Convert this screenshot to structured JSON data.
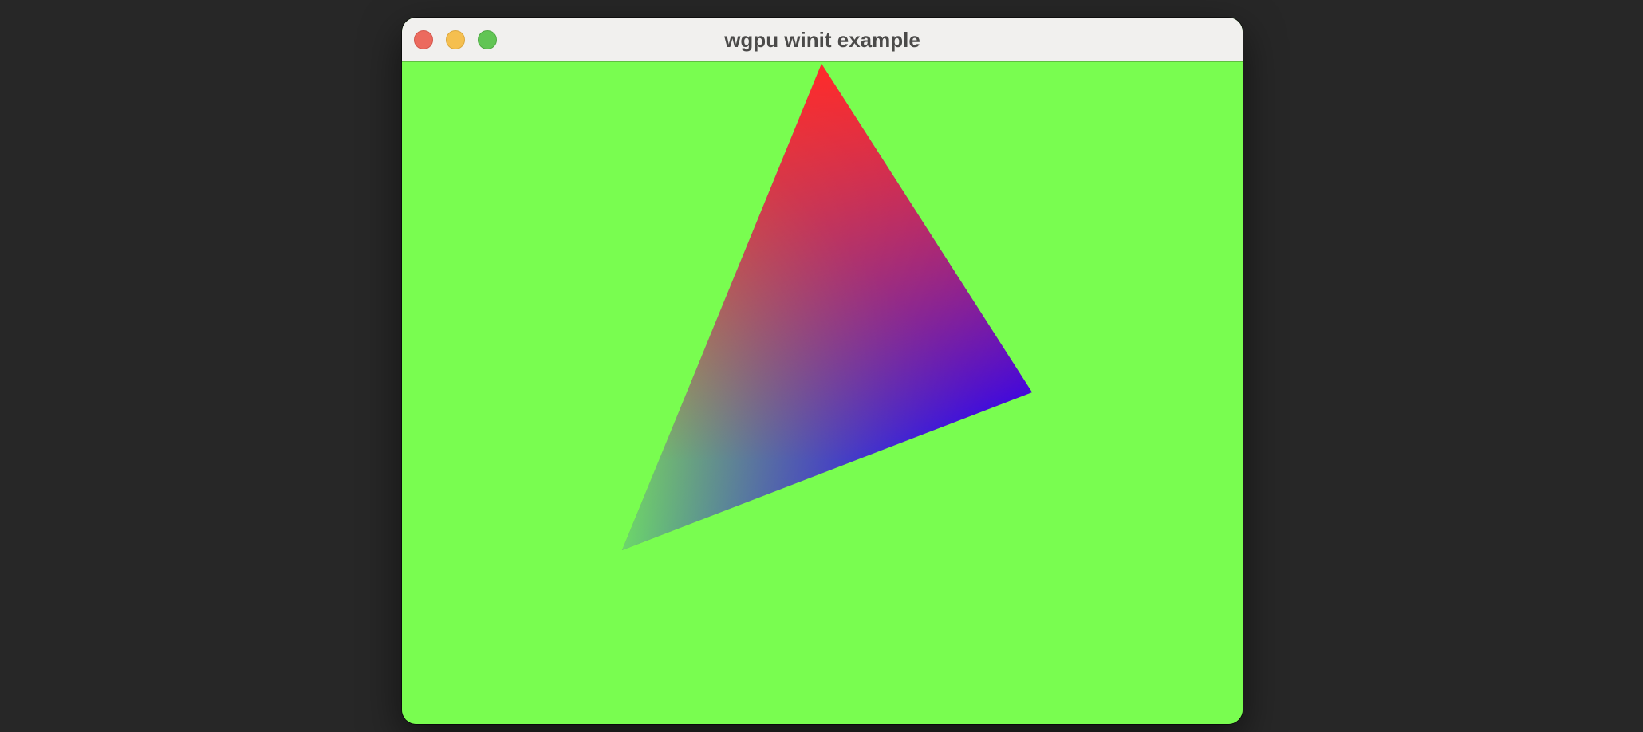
{
  "window": {
    "title": "wgpu winit example"
  },
  "colors": {
    "desktop_background": "#272727",
    "clear_color": "#79fd50",
    "titlebar": "#f1f0ee",
    "close_button": "#ec6a5e",
    "minimize_button": "#f5bf4f",
    "maximize_button": "#61c554"
  },
  "scene": {
    "shape": "triangle",
    "vertex_colors": {
      "top": "#ff2a2a",
      "right": "#1e00ff",
      "bottom_left": "#79fd50"
    }
  }
}
